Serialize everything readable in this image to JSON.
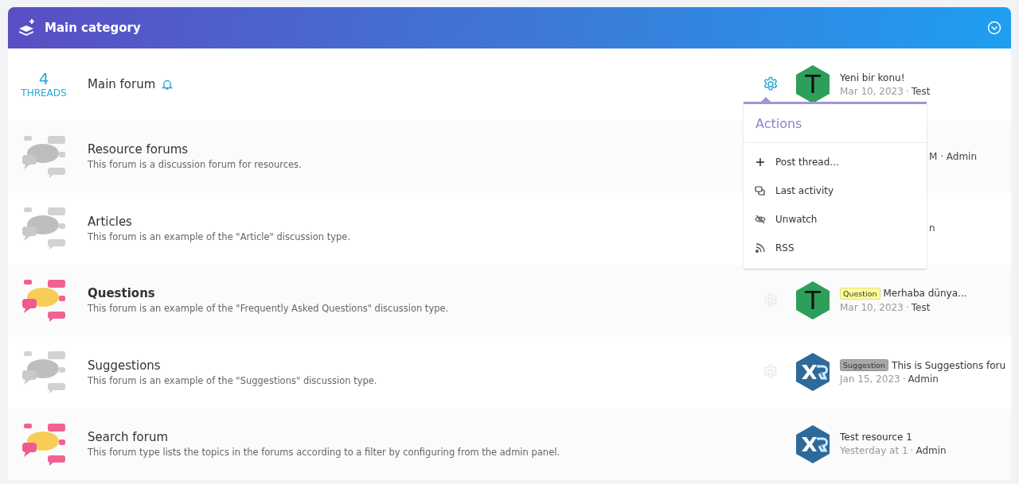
{
  "category": {
    "title": "Main category",
    "collapsed": false
  },
  "forums": [
    {
      "title": "Main forum",
      "count": "4",
      "count_label": "THREADS",
      "watched": true,
      "bold": false,
      "gear_active": true,
      "latest": {
        "avatar": {
          "kind": "letter",
          "letter": "T"
        },
        "title": "Yeni bir konu!",
        "date": "Mar 10, 2023",
        "separator": "·",
        "author": "Test"
      }
    },
    {
      "title": "Resource forums",
      "description": "This forum is a discussion forum for resources.",
      "bold": false,
      "highlighted": false,
      "latest_fragment": "M · Admin"
    },
    {
      "title": "Articles",
      "description": "This forum is an example of the \"Article\" discussion type.",
      "bold": false,
      "highlighted": false,
      "latest_fragment": "n"
    },
    {
      "title": "Questions",
      "description": "This forum is an example of the \"Frequently Asked Questions\" discussion type.",
      "bold": true,
      "highlighted": true,
      "gear_active": false,
      "latest": {
        "avatar": {
          "kind": "letter",
          "letter": "T"
        },
        "prefix": {
          "label": "Question",
          "color": "#ffff99"
        },
        "title": "Merhaba dünya...",
        "date": "Mar 10, 2023",
        "separator": "·",
        "author": "Test"
      }
    },
    {
      "title": "Suggestions",
      "description": "This forum is an example of the \"Suggestions\" discussion type.",
      "bold": false,
      "highlighted": false,
      "gear_active": false,
      "latest": {
        "avatar": {
          "kind": "logo"
        },
        "prefix": {
          "label": "Suggestion",
          "color": "#a8a8a8"
        },
        "title": "This is Suggestions foru",
        "date": "Jan 15, 2023",
        "separator": "·",
        "author": "Admin"
      }
    },
    {
      "title": "Search forum",
      "description": "This forum type lists the topics in the forums according to a filter by configuring from the admin panel.",
      "bold": false,
      "highlighted": true,
      "latest": {
        "avatar": {
          "kind": "logo"
        },
        "title": "Test resource 1",
        "date": "Yesterday at 1",
        "separator": "·",
        "author": "Admin"
      }
    }
  ],
  "menu": {
    "title": "Actions",
    "items": [
      {
        "kind": "plus",
        "label": "Post thread..."
      },
      {
        "kind": "chat",
        "label": "Last activity"
      },
      {
        "kind": "unwatch",
        "label": "Unwatch"
      },
      {
        "kind": "rss",
        "label": "RSS"
      }
    ]
  }
}
